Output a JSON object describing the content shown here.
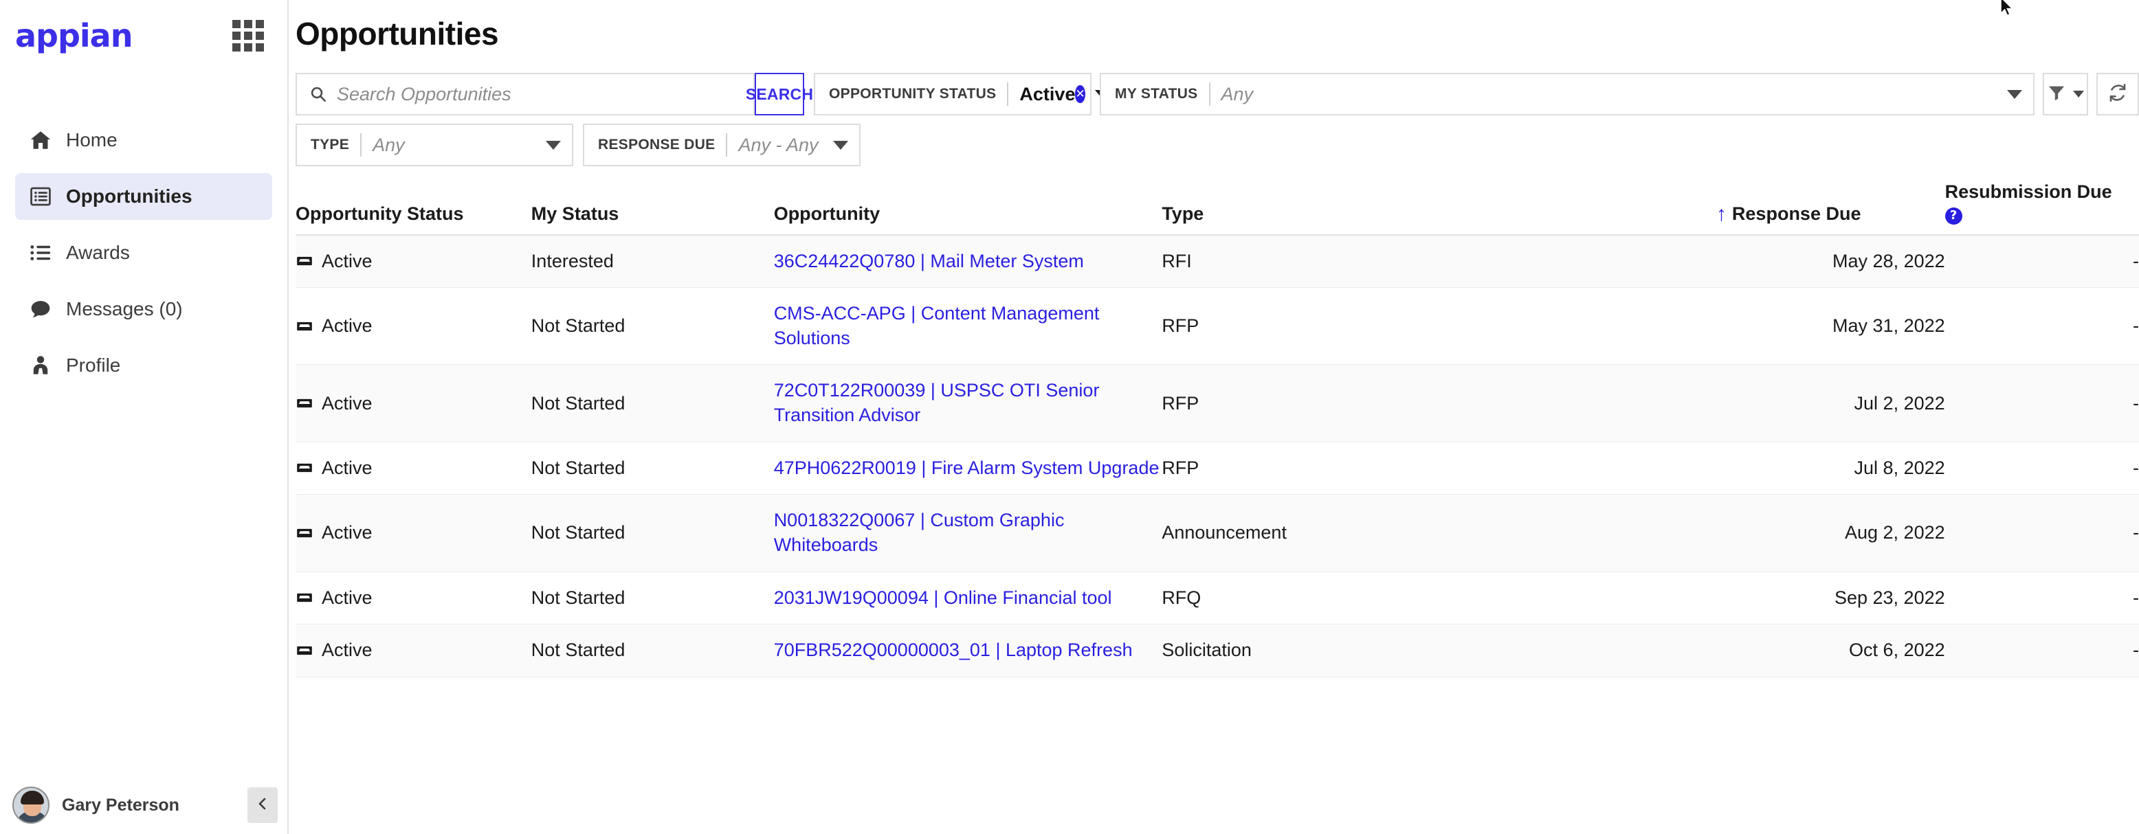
{
  "brand": {
    "logo_text": "appian",
    "apps_icon": "grid-apps-icon"
  },
  "sidebar": {
    "items": [
      {
        "label": "Home",
        "icon": "home-icon",
        "active": false
      },
      {
        "label": "Opportunities",
        "icon": "list-box-icon",
        "active": true
      },
      {
        "label": "Awards",
        "icon": "bullet-list-icon",
        "active": false
      },
      {
        "label": "Messages (0)",
        "icon": "chat-bubble-icon",
        "active": false
      },
      {
        "label": "Profile",
        "icon": "user-tie-icon",
        "active": false
      }
    ],
    "user": {
      "name": "Gary Peterson",
      "avatar": "user-avatar",
      "collapse_icon": "chevron-left-icon"
    }
  },
  "header": {
    "title": "Opportunities"
  },
  "search": {
    "placeholder": "Search Opportunities",
    "value": "",
    "icon": "search-icon",
    "button_label": "SEARCH"
  },
  "filters": [
    {
      "name": "opportunity-status",
      "label": "OPPORTUNITY STATUS",
      "value": "Active",
      "is_placeholder": false,
      "clearable": true
    },
    {
      "name": "my-status",
      "label": "MY STATUS",
      "value": "Any",
      "is_placeholder": true,
      "clearable": false
    },
    {
      "name": "type",
      "label": "TYPE",
      "value": "Any",
      "is_placeholder": true,
      "clearable": false
    },
    {
      "name": "response-due",
      "label": "RESPONSE DUE",
      "value": "Any - Any",
      "is_placeholder": true,
      "clearable": false
    }
  ],
  "toolbar": {
    "filter_icon": "funnel-icon",
    "filter_caret_icon": "chevron-down-icon",
    "refresh_icon": "refresh-icon"
  },
  "table": {
    "columns": [
      {
        "key": "opportunity_status",
        "label": "Opportunity Status",
        "align": "left"
      },
      {
        "key": "my_status",
        "label": "My Status",
        "align": "left"
      },
      {
        "key": "opportunity",
        "label": "Opportunity",
        "align": "left"
      },
      {
        "key": "type",
        "label": "Type",
        "align": "left"
      },
      {
        "key": "response_due",
        "label": "Response Due",
        "align": "right",
        "sorted": true,
        "sort_direction": "asc",
        "sort_icon": "arrow-up-icon"
      },
      {
        "key": "resubmission_due",
        "label": "Resubmission Due",
        "align": "right",
        "help_icon": "question-mark-icon"
      }
    ],
    "rows": [
      {
        "opportunity_status": "Active",
        "status_icon": "inbox-tray-icon",
        "my_status": "Interested",
        "opportunity": "36C24422Q0780 | Mail Meter System",
        "type": "RFI",
        "response_due": "May 28, 2022",
        "resubmission_due": "-"
      },
      {
        "opportunity_status": "Active",
        "status_icon": "inbox-tray-icon",
        "my_status": "Not Started",
        "opportunity": "CMS-ACC-APG | Content Management Solutions",
        "type": "RFP",
        "response_due": "May 31, 2022",
        "resubmission_due": "-"
      },
      {
        "opportunity_status": "Active",
        "status_icon": "inbox-tray-icon",
        "my_status": "Not Started",
        "opportunity": "72C0T122R00039 | USPSC OTI Senior Transition Advisor",
        "type": "RFP",
        "response_due": "Jul 2, 2022",
        "resubmission_due": "-"
      },
      {
        "opportunity_status": "Active",
        "status_icon": "inbox-tray-icon",
        "my_status": "Not Started",
        "opportunity": "47PH0622R0019 | Fire Alarm System Upgrade",
        "type": "RFP",
        "response_due": "Jul 8, 2022",
        "resubmission_due": "-"
      },
      {
        "opportunity_status": "Active",
        "status_icon": "inbox-tray-icon",
        "my_status": "Not Started",
        "opportunity": "N0018322Q0067 | Custom Graphic Whiteboards",
        "type": "Announcement",
        "response_due": "Aug 2, 2022",
        "resubmission_due": "-"
      },
      {
        "opportunity_status": "Active",
        "status_icon": "inbox-tray-icon",
        "my_status": "Not Started",
        "opportunity": "2031JW19Q00094 | Online Financial tool",
        "type": "RFQ",
        "response_due": "Sep 23, 2022",
        "resubmission_due": "-"
      },
      {
        "opportunity_status": "Active",
        "status_icon": "inbox-tray-icon",
        "my_status": "Not Started",
        "opportunity": "70FBR522Q00000003_01 | Laptop Refresh",
        "type": "Solicitation",
        "response_due": "Oct 6, 2022",
        "resubmission_due": "-"
      }
    ]
  },
  "colors": {
    "accent": "#2a1fe0",
    "brand": "#3b2fe8",
    "sidebar_active_bg": "#e8eaf9",
    "row_alt_bg": "#fafafa",
    "border": "#dcdcdc",
    "text": "#1b1b1b"
  }
}
